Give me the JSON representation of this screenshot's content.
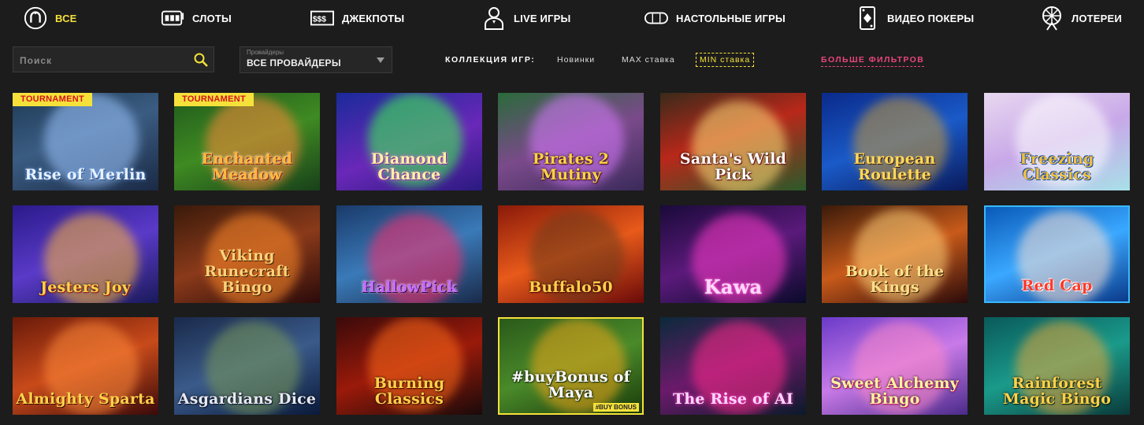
{
  "nav": [
    {
      "label": "ВСЕ",
      "icon": "horseshoe-icon",
      "active": true
    },
    {
      "label": "СЛОТЫ",
      "icon": "slot-machine-icon",
      "active": false
    },
    {
      "label": "ДЖЕКПОТЫ",
      "icon": "jackpot-icon",
      "active": false
    },
    {
      "label": "LIVE ИГРЫ",
      "icon": "dealer-icon",
      "active": false
    },
    {
      "label": "НАСТОЛЬНЫЕ ИГРЫ",
      "icon": "table-icon",
      "active": false
    },
    {
      "label": "ВИДЕО ПОКЕРЫ",
      "icon": "playing-card-icon",
      "active": false
    },
    {
      "label": "ЛОТЕРЕИ",
      "icon": "lottery-wheel-icon",
      "active": false
    }
  ],
  "search": {
    "placeholder": "Поиск"
  },
  "provider": {
    "caption": "Провайдеры",
    "value": "ВСЕ ПРОВАЙДЕРЫ"
  },
  "collection": {
    "label": "КОЛЛЕКЦИЯ ИГР:",
    "links": [
      "Новинки",
      "MAX ставка",
      "MIN ставка"
    ],
    "selected": "MIN ставка"
  },
  "more_filters": "БОЛЬШЕ ФИЛЬТРОВ",
  "colors": {
    "accent": "#f5e13a",
    "pink": "#e8467e",
    "background": "#1c1c1c"
  },
  "games": [
    {
      "title": "Rise of Merlin",
      "badge": "TOURNAMENT"
    },
    {
      "title": "Enchanted Meadow",
      "badge": "TOURNAMENT"
    },
    {
      "title": "Diamond Chance",
      "badge": ""
    },
    {
      "title": "Pirates 2 Mutiny",
      "badge": ""
    },
    {
      "title": "Santa's Wild Pick",
      "badge": ""
    },
    {
      "title": "European Roulette",
      "badge": ""
    },
    {
      "title": "Freezing Classics",
      "badge": ""
    },
    {
      "title": "Jesters Joy",
      "badge": ""
    },
    {
      "title": "Viking Runecraft Bingo",
      "badge": ""
    },
    {
      "title": "HallowPick",
      "badge": ""
    },
    {
      "title": "Buffalo50",
      "badge": ""
    },
    {
      "title": "Kawa",
      "badge": ""
    },
    {
      "title": "Book of the Kings",
      "badge": ""
    },
    {
      "title": "Red Cap",
      "badge": ""
    },
    {
      "title": "Almighty Sparta",
      "badge": ""
    },
    {
      "title": "Asgardians Dice",
      "badge": ""
    },
    {
      "title": "Burning Classics",
      "badge": ""
    },
    {
      "title": "#buyBonus of Maya",
      "badge": "#BUY BONUS"
    },
    {
      "title": "The Rise of AI",
      "badge": ""
    },
    {
      "title": "Sweet Alchemy Bingo",
      "badge": ""
    },
    {
      "title": "Rainforest Magic Bingo",
      "badge": ""
    }
  ]
}
